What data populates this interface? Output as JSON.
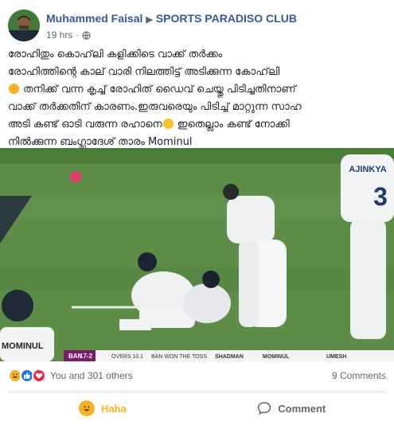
{
  "post": {
    "author": "Muhammed Faisal",
    "group": "SPORTS PARADISO CLUB",
    "time": "19 hrs",
    "separator": "·",
    "text_lines": [
      "രോഹിതും കൊഹ്‌ലി കളിക്കിടെ വാക്ക് തർക്കം",
      "രോഹിത്തിന്റെ കാല് വാരി നിലത്തിട്ട് അടിക്കുന്ന കോഹ്‌ലി",
      "തനിക്ക് വന്ന കൃച്ച് രോഹിത് ഡൈവ് ചെയ്തു പിടിച്ചതിനാണ്",
      "വാക്ക് തർക്കതിന് കാരണം.ഇരുവരെയും പിടിച്ച് മാറ്റുന്ന സാഹ",
      "അടി കണ്ട് ഓടി വരുന്ന രഹാനെ",
      "ഇതെല്ലാം കണ്ട് നോക്കി",
      "നിൽക്കുന്ന ബംഗ്ലാദേശ് താരം Mominul"
    ]
  },
  "photo": {
    "jersey_name": "AJINKYA",
    "jersey_number": "3",
    "cap_text": "MOMINUL",
    "scorebar": {
      "team": "BAN",
      "score": "17-2",
      "overs": "OVERS 10.1",
      "toss": "BAN WON THE TOSS",
      "batter1": "SHADMAN",
      "batter2": "MOMINUL",
      "bowler": "UMESH"
    }
  },
  "stats": {
    "reactions_text": "You and 301 others",
    "comments_text": "9 Comments"
  },
  "actions": {
    "haha_label": "Haha",
    "comment_label": "Comment"
  },
  "colors": {
    "link": "#385898",
    "haha": "#f7b125",
    "like": "#1877f2",
    "love": "#f0284a",
    "grass": "#5c8a45"
  }
}
